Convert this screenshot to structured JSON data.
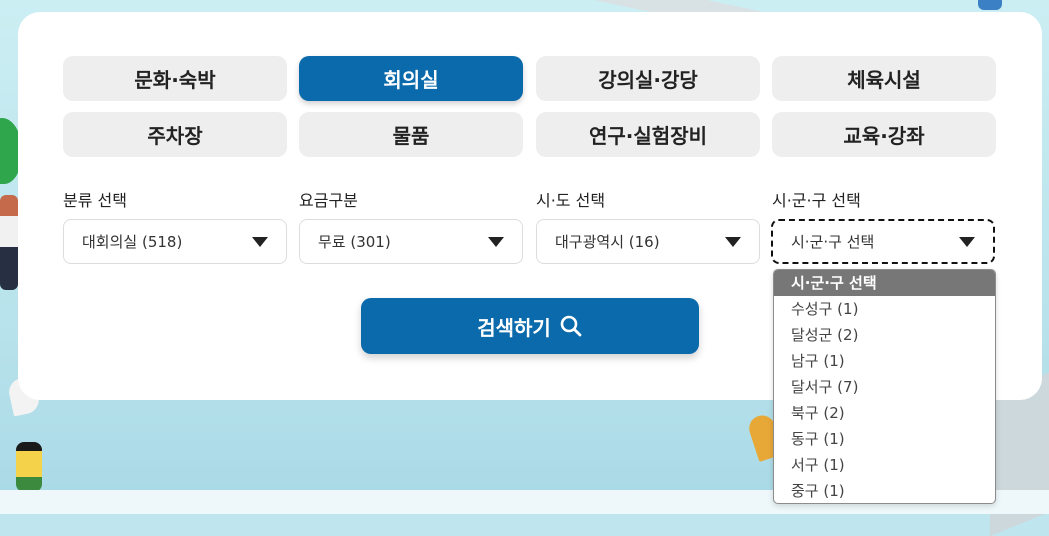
{
  "categories": [
    {
      "label": "문화·숙박",
      "active": false
    },
    {
      "label": "회의실",
      "active": true
    },
    {
      "label": "강의실·강당",
      "active": false
    },
    {
      "label": "체육시설",
      "active": false
    },
    {
      "label": "주차장",
      "active": false
    },
    {
      "label": "물품",
      "active": false
    },
    {
      "label": "연구·실험장비",
      "active": false
    },
    {
      "label": "교육·강좌",
      "active": false
    }
  ],
  "filters": {
    "category": {
      "label": "분류 선택",
      "value": "대회의실 (518)"
    },
    "fee": {
      "label": "요금구분",
      "value": "무료 (301)"
    },
    "province": {
      "label": "시·도 선택",
      "value": "대구광역시 (16)"
    },
    "district": {
      "label": "시·군·구 선택",
      "value": "시·군·구 선택"
    }
  },
  "search_button": {
    "label": "검색하기",
    "icon": "search-icon"
  },
  "district_dropdown": {
    "options": [
      "시·군·구 선택",
      "수성구 (1)",
      "달성군 (2)",
      "남구 (1)",
      "달서구 (7)",
      "북구 (2)",
      "동구 (1)",
      "서구 (1)",
      "중구 (1)"
    ],
    "selected": "시·군·구 선택"
  },
  "colors": {
    "primary": "#0b6aab",
    "inactive_button": "#eeeeee",
    "dropdown_selected": "#777777",
    "background": "#bfe6ee"
  }
}
